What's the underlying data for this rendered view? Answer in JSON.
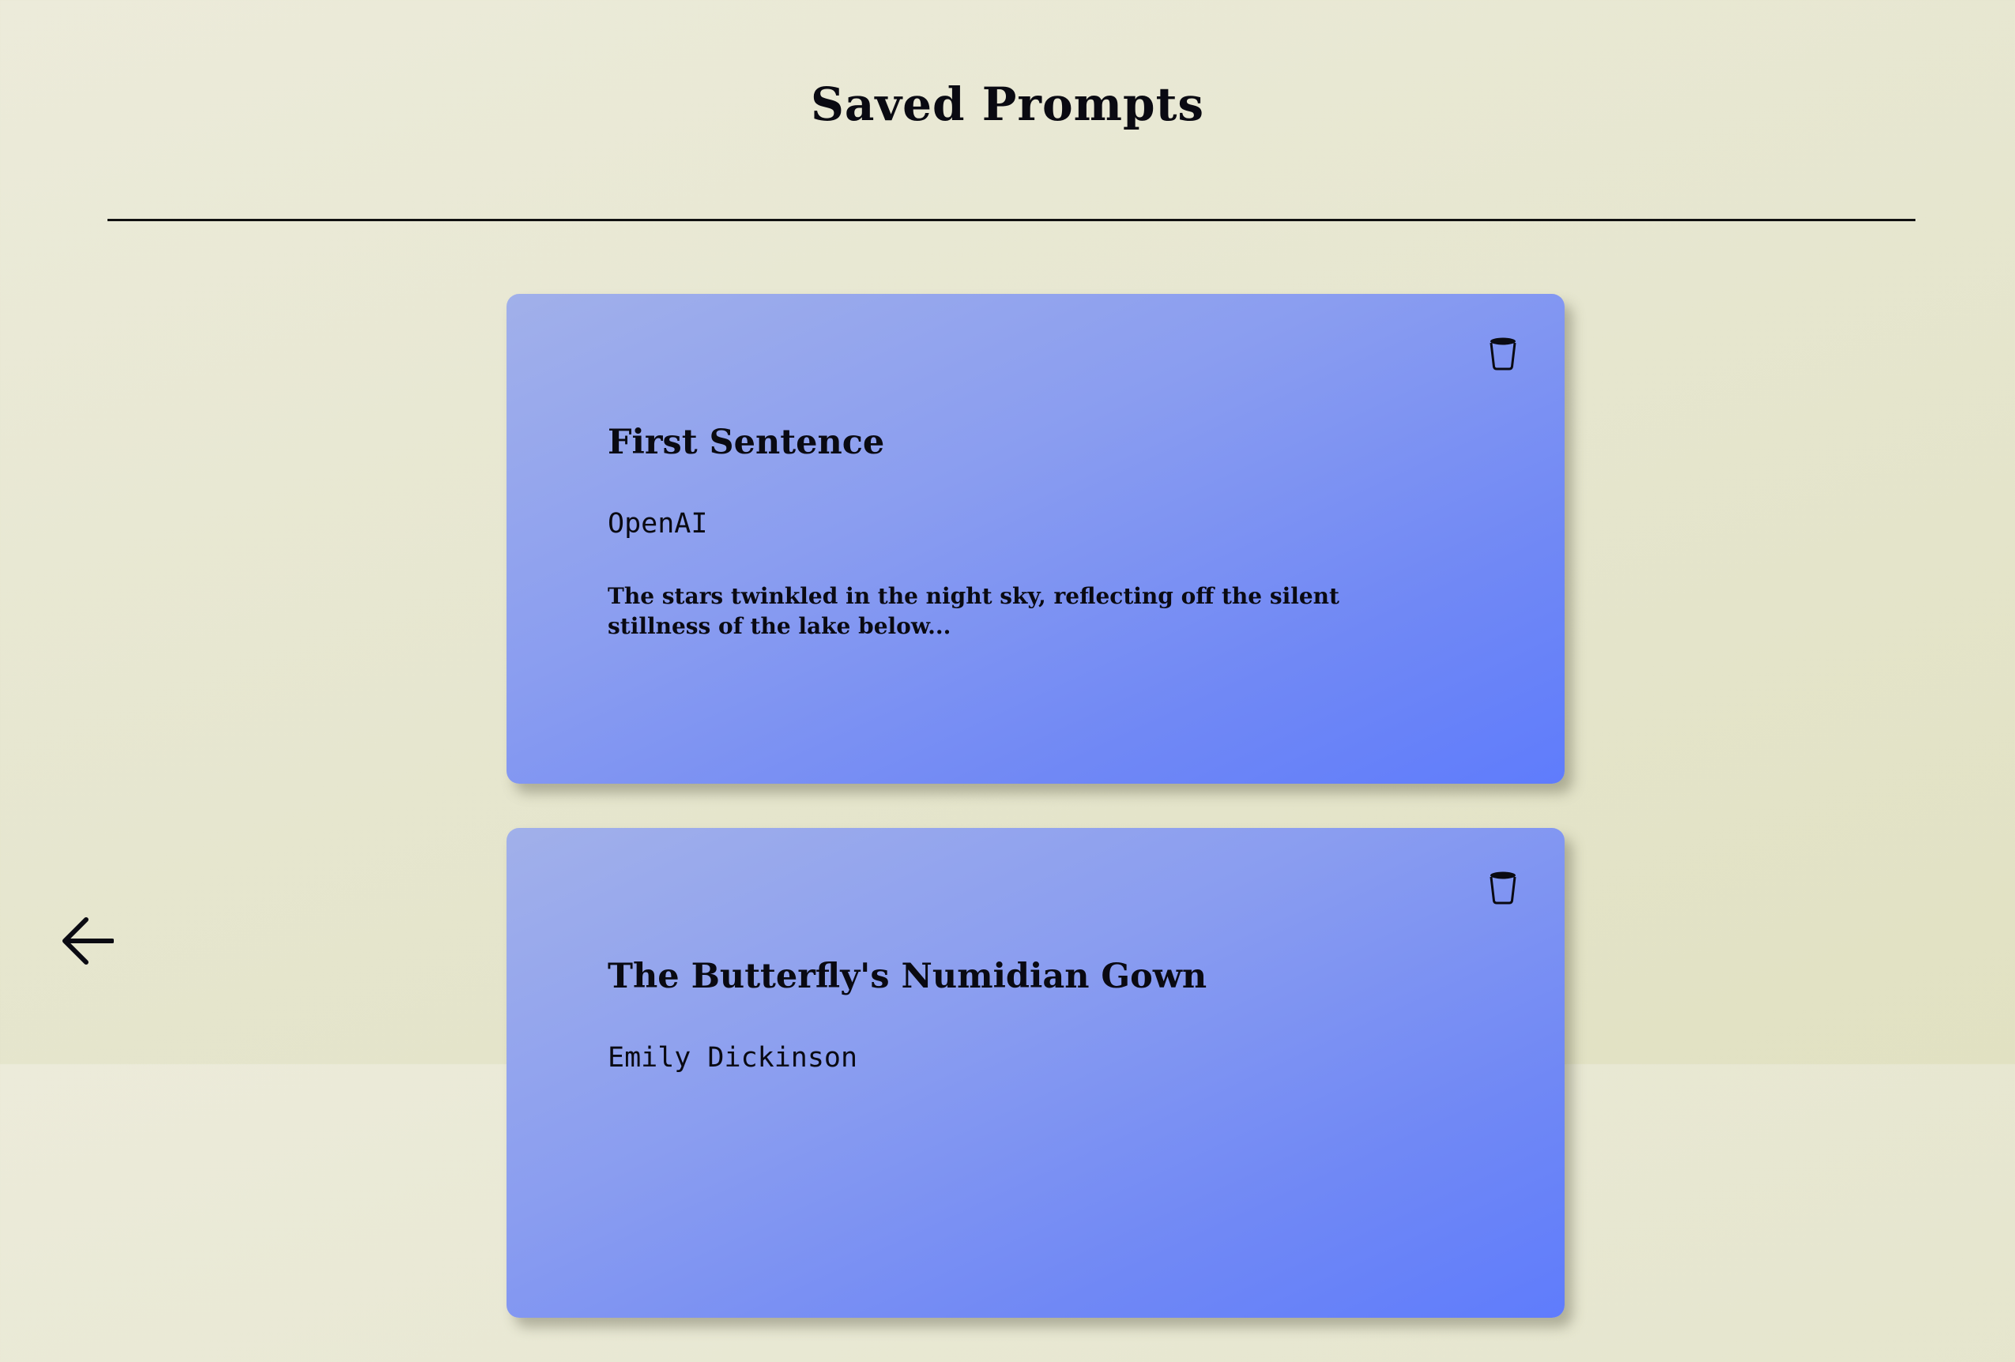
{
  "page": {
    "title": "Saved Prompts"
  },
  "prompts": [
    {
      "title": "First Sentence",
      "author": "OpenAI",
      "text": "The stars twinkled in the night sky, reflecting off the silent stillness of the lake below...",
      "delete_icon": "trash-icon"
    },
    {
      "title": "The Butterfly's Numidian Gown",
      "author": "Emily Dickinson",
      "text": "",
      "delete_icon": "trash-icon"
    }
  ],
  "nav": {
    "back_icon": "arrow-left-icon"
  },
  "colors": {
    "background": "#e8e8d2",
    "card_gradient_start": "#a1b0ea",
    "card_gradient_end": "#5f7cfc",
    "text": "#0a0a12"
  }
}
